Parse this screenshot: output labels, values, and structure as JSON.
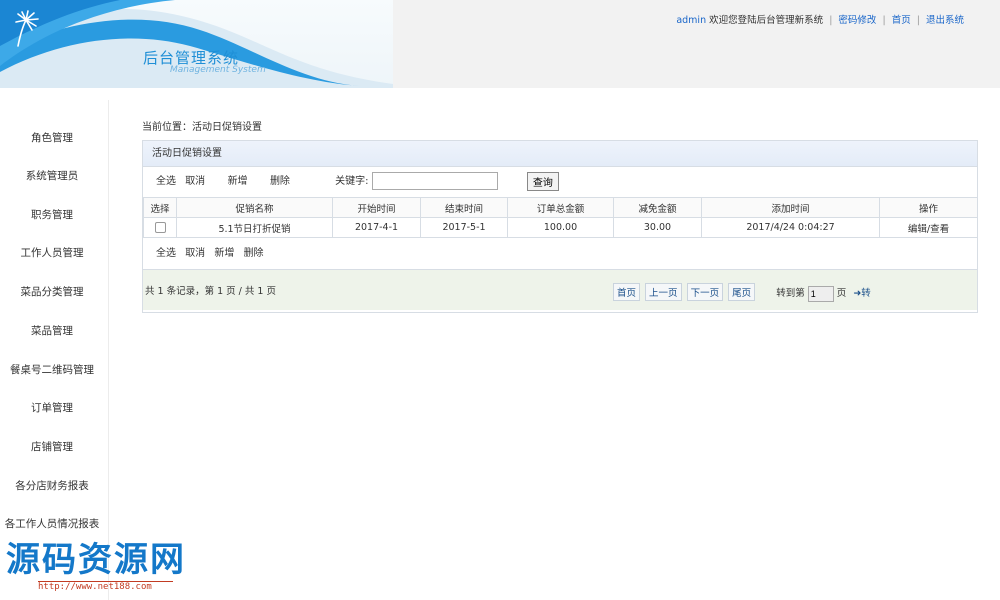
{
  "header": {
    "title": "后台管理系统",
    "subtitle": "Management System",
    "user": "admin",
    "welcome": "欢迎您登陆后台管理新系统",
    "links": [
      "密码修改",
      "首页",
      "退出系统"
    ]
  },
  "sidebar": {
    "items": [
      "角色管理",
      "系统管理员",
      "职务管理",
      "工作人员管理",
      "菜品分类管理",
      "菜品管理",
      "餐桌号二维码管理",
      "订单管理",
      "店铺管理",
      "各分店财务报表",
      "各工作人员情况报表"
    ]
  },
  "breadcrumb": "当前位置：活动日促销设置",
  "panel": {
    "title": "活动日促销设置",
    "toolbar": {
      "select_all": "全选",
      "cancel": "取消",
      "add": "新增",
      "delete": "删除",
      "keyword_label": "关键字:",
      "keyword_value": "",
      "search_button": "查询"
    },
    "table": {
      "headers": [
        "选择",
        "促销名称",
        "开始时间",
        "结束时间",
        "订单总金额",
        "减免金额",
        "添加时间",
        "操作"
      ],
      "rows": [
        {
          "name": "5.1节日打折促销",
          "start": "2017-4-1",
          "end": "2017-5-1",
          "total": "100.00",
          "discount": "30.00",
          "added": "2017/4/24 0:04:27",
          "action": "编辑/查看"
        }
      ]
    },
    "pager": {
      "info": "共 1 条记录，第 1 页 / 共 1 页",
      "first": "首页",
      "prev": "上一页",
      "next": "下一页",
      "last": "尾页",
      "goto_label": "转到第",
      "page_value": "1",
      "page_unit": "页",
      "go": "转"
    }
  },
  "watermark": {
    "title": "源码资源网",
    "url": "http://www.net188.com"
  },
  "colors": {
    "brand": "#1f8fd6",
    "link": "#1a66c9",
    "watermark": "#1478c9",
    "pager_bg": "#eef3ea",
    "panel_head": "#e4ecf8"
  }
}
